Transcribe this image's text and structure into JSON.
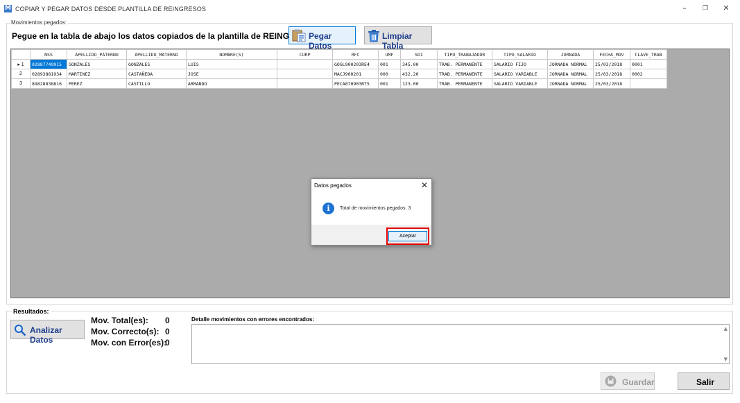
{
  "window": {
    "title": "COPIAR Y PEGAR DATOS DESDE PLANTILLA DE REINGRESOS",
    "app_icon": "M",
    "minimize": "–",
    "restore": "❐",
    "close": "✕"
  },
  "pasted_group": {
    "label": "Movimientos pegados:",
    "instruction": "Pegue en la tabla de abajo los datos copiados de la plantilla de REINGRESOS.",
    "paste_button": "Pegar Datos",
    "clear_button": "Limpiar Tabla"
  },
  "grid": {
    "columns": [
      "NSS",
      "APELLIDO_PATERNO",
      "APELLIDO_MATERNO",
      "NOMBRE(S)",
      "CURP",
      "RFC",
      "UMF",
      "SDI",
      "TIPO_TRABAJADOR",
      "TIPO_SALARIO",
      "JORNADA",
      "FECHA_MOV",
      "CLAVE_TRAB"
    ],
    "rows": [
      {
        "header": "▸ 1",
        "cells": [
          "02887749915",
          "GONZALES",
          "GONZALES",
          "LUIS",
          "",
          "GOGL900203RE4",
          "001",
          "345.00",
          "TRAB. PERMANENTE",
          "SALARIO FIJO",
          "JORNADA NORMAL",
          "25/03/2018",
          "0001"
        ]
      },
      {
        "header": "2",
        "cells": [
          "02893881934",
          "MARTINEZ",
          "CASTAÑEDA",
          "JOSE",
          "",
          "MACJ900201",
          "000",
          "432.20",
          "TRAB. PERMANENTE",
          "SALARIO VARIABLE",
          "JORNADA NORMAL",
          "25/03/2018",
          "0002"
        ]
      },
      {
        "header": "3",
        "cells": [
          "89828838816",
          "PEREZ",
          "CASTILLO",
          "ARMANDO",
          "",
          "PECA870903RT5",
          "001",
          "123.00",
          "TRAB. PERMANENTE",
          "SALARIO VARIABLE",
          "JORNADA NORMAL",
          "25/03/2018",
          ""
        ]
      }
    ]
  },
  "dialog": {
    "title": "Datos pegados",
    "close": "✕",
    "icon": "info-icon",
    "info_glyph": "i",
    "message": "Total de movimientos pegados: 3",
    "ok_button": "Aceptar"
  },
  "results": {
    "label": "Resultados:",
    "analyze_button": "Analizar Datos",
    "total_label": "Mov. Total(es):",
    "total_value": "0",
    "correct_label": "Mov. Correcto(s):",
    "correct_value": "0",
    "errors_label": "Mov. con Error(es):",
    "errors_value": "0",
    "detail_label": "Detalle movimientos con errores encontrados:",
    "detail_text": "",
    "save_button": "Guardar",
    "exit_button": "Salir"
  },
  "colors": {
    "accent": "#0078d7",
    "button_text": "#1f3d8c",
    "highlight": "#e30000",
    "grid_bg": "#ababab"
  }
}
